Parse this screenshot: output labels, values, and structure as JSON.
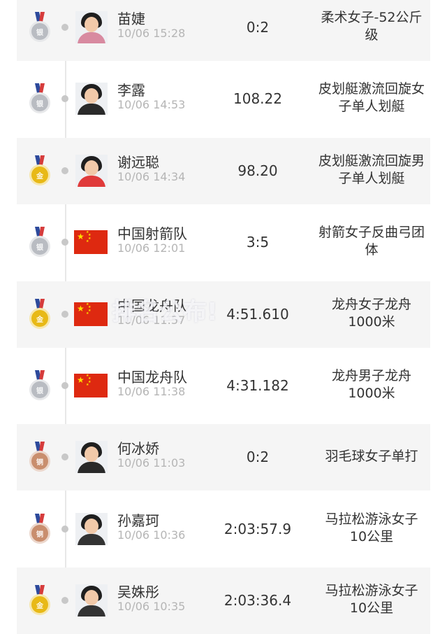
{
  "rows": [
    {
      "name": "苗婕",
      "time": "10/06 15:28",
      "score": "0:2",
      "event_line1": "柔术女子-52公斤",
      "event_line2": "级",
      "medal": "silver",
      "medal_glyph": "银",
      "avatar": "photo",
      "shirt": "#d88aa0"
    },
    {
      "name": "李露",
      "time": "10/06 14:53",
      "score": "108.22",
      "event_line1": "皮划艇激流回旋女",
      "event_line2": "子单人划艇",
      "medal": "silver",
      "medal_glyph": "银",
      "avatar": "photo",
      "shirt": "#2a2a2a"
    },
    {
      "name": "谢远聪",
      "time": "10/06 14:34",
      "score": "98.20",
      "event_line1": "皮划艇激流回旋男",
      "event_line2": "子单人划艇",
      "medal": "gold",
      "medal_glyph": "金",
      "avatar": "photo",
      "shirt": "#e03a3a"
    },
    {
      "name": "中国射箭队",
      "time": "10/06 12:01",
      "score": "3:5",
      "event_line1": "射箭女子反曲弓团",
      "event_line2": "体",
      "medal": "silver",
      "medal_glyph": "银",
      "avatar": "flag",
      "shirt": ""
    },
    {
      "name": "中国龙舟队",
      "time": "10/06 11:57",
      "score": "4:51.610",
      "event_line1": "龙舟女子龙舟",
      "event_line2": "1000米",
      "medal": "gold",
      "medal_glyph": "金",
      "avatar": "flag",
      "shirt": ""
    },
    {
      "name": "中国龙舟队",
      "time": "10/06 11:38",
      "score": "4:31.182",
      "event_line1": "龙舟男子龙舟",
      "event_line2": "1000米",
      "medal": "silver",
      "medal_glyph": "银",
      "avatar": "flag",
      "shirt": ""
    },
    {
      "name": "何冰娇",
      "time": "10/06 11:03",
      "score": "0:2",
      "event_line1": "羽毛球女子单打",
      "event_line2": "",
      "medal": "bronze",
      "medal_glyph": "铜",
      "avatar": "photo",
      "shirt": "#2a2a2a"
    },
    {
      "name": "孙嘉珂",
      "time": "10/06 10:36",
      "score": "2:03:57.9",
      "event_line1": "马拉松游泳女子",
      "event_line2": "10公里",
      "medal": "bronze",
      "medal_glyph": "铜",
      "avatar": "photo",
      "shirt": "#333333"
    },
    {
      "name": "吴姝彤",
      "time": "10/06 10:35",
      "score": "2:03:36.4",
      "event_line1": "马拉松游泳女子",
      "event_line2": "10公里",
      "medal": "gold",
      "medal_glyph": "金",
      "avatar": "photo",
      "shirt": "#333333"
    }
  ],
  "watermark": "排名公布!",
  "colors": {
    "gold": "#e8b916",
    "silver": "#b9bcc2",
    "bronze": "#c98e6e",
    "ribbon_a": "#2d4a9c",
    "ribbon_b": "#d63c3c",
    "row_shade": "#f5f5f5",
    "time": "#b5b5b5"
  }
}
